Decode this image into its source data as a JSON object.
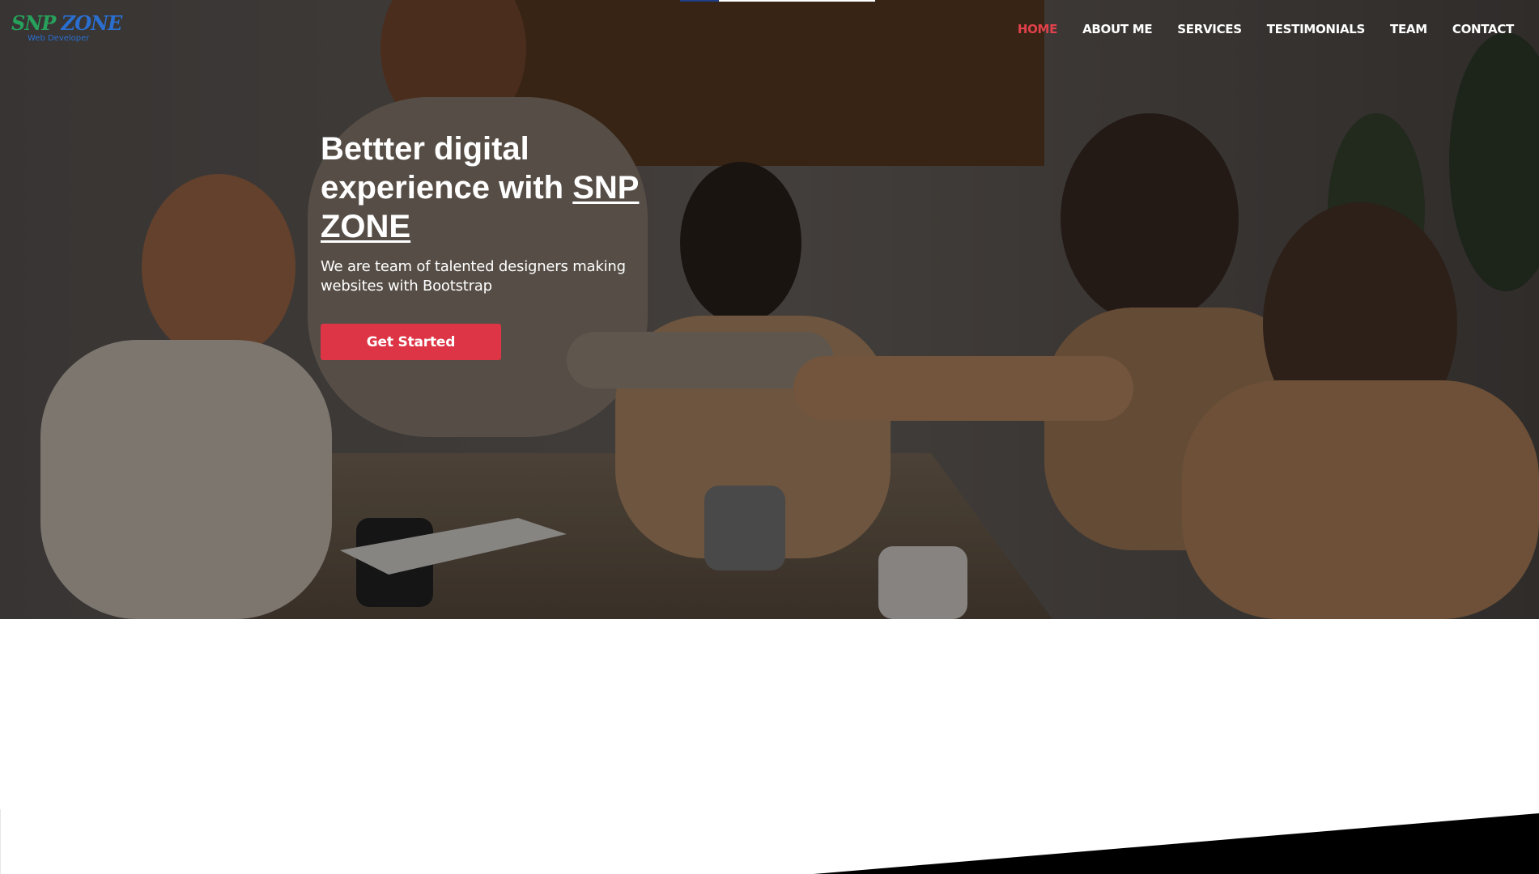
{
  "header": {
    "logo": {
      "text_part1": "SNP ",
      "text_part2": "ZONE",
      "tagline": "Web Developer"
    },
    "nav": [
      {
        "label": "HOME",
        "active": true
      },
      {
        "label": "ABOUT ME",
        "active": false
      },
      {
        "label": "SERVICES",
        "active": false
      },
      {
        "label": "TESTIMONIALS",
        "active": false
      },
      {
        "label": "TEAM",
        "active": false
      },
      {
        "label": "CONTACT",
        "active": false
      }
    ]
  },
  "scroll_progress": 0.2,
  "hero": {
    "title_before": "Bettter digital experience with ",
    "title_brand": "SNP ZONE",
    "subtitle": "We are team of talented designers making websites with Bootstrap",
    "cta_label": "Get Started"
  },
  "colors": {
    "accent": "#dd3545",
    "nav_active": "#e0414a",
    "logo_green": "#26a05a",
    "logo_blue": "#2a6fd0",
    "scroll_fill": "#1f3f86"
  }
}
